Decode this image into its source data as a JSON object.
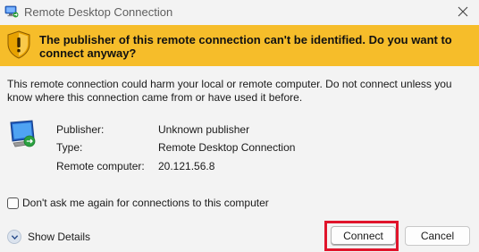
{
  "window": {
    "title": "Remote Desktop Connection",
    "app_icon": "remote-desktop-icon",
    "close_icon": "close-icon"
  },
  "banner": {
    "icon": "shield-warning-icon",
    "message": "The publisher of this remote connection can't be identified. Do you want to connect anyway?",
    "color": "#f6bd2a"
  },
  "body": {
    "warning_text": "This remote connection could harm your local or remote computer. Do not connect unless you know where this connection came from or have used it before.",
    "icon": "monitor-icon",
    "details": [
      {
        "label": "Publisher:",
        "value": "Unknown publisher"
      },
      {
        "label": "Type:",
        "value": "Remote Desktop Connection"
      },
      {
        "label": "Remote computer:",
        "value": "20.121.56.8"
      }
    ]
  },
  "checkbox": {
    "label": "Don't ask me again for connections to this computer",
    "checked": false
  },
  "footer": {
    "show_details_label": "Show Details",
    "show_details_icon": "chevron-down-icon",
    "connect_label": "Connect",
    "cancel_label": "Cancel",
    "highlight_color": "#e0142b"
  }
}
